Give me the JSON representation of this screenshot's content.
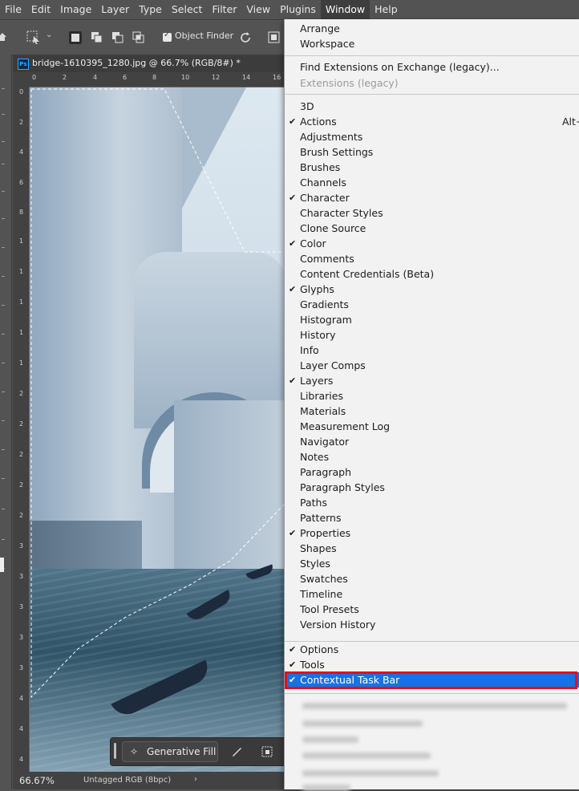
{
  "menubar": {
    "items": [
      "File",
      "Edit",
      "Image",
      "Layer",
      "Type",
      "Select",
      "Filter",
      "View",
      "Plugins",
      "Window",
      "Help"
    ],
    "active": "Window"
  },
  "options_bar": {
    "object_finder_label": "Object Finder"
  },
  "document": {
    "tab_title": "bridge-1610395_1280.jpg @ 66.7% (RGB/8#) *",
    "ps_badge": "Ps",
    "ruler_top": [
      "0",
      "2",
      "4",
      "6",
      "8",
      "10",
      "12",
      "14",
      "16"
    ],
    "ruler_left": [
      "0",
      "2",
      "4",
      "6",
      "8",
      "1",
      "1",
      "1",
      "1",
      "1",
      "2",
      "2",
      "2",
      "2",
      "2",
      "3",
      "3",
      "3",
      "3",
      "3",
      "4",
      "4",
      "4"
    ]
  },
  "context_bar": {
    "generative_fill_label": "Generative Fill"
  },
  "status_bar": {
    "zoom": "66.67%",
    "doc_info": "Untagged RGB (8bpc)",
    "arrow": "›"
  },
  "window_menu": {
    "group1": [
      {
        "label": "Arrange"
      },
      {
        "label": "Workspace"
      }
    ],
    "group2": [
      {
        "label": "Find Extensions on Exchange (legacy)..."
      },
      {
        "label": "Extensions (legacy)",
        "disabled": true
      }
    ],
    "group3": [
      {
        "label": "3D",
        "checked": false
      },
      {
        "label": "Actions",
        "checked": true,
        "shortcut": "Alt+"
      },
      {
        "label": "Adjustments",
        "checked": false
      },
      {
        "label": "Brush Settings",
        "checked": false
      },
      {
        "label": "Brushes",
        "checked": false
      },
      {
        "label": "Channels",
        "checked": false
      },
      {
        "label": "Character",
        "checked": true
      },
      {
        "label": "Character Styles",
        "checked": false
      },
      {
        "label": "Clone Source",
        "checked": false
      },
      {
        "label": "Color",
        "checked": true
      },
      {
        "label": "Comments",
        "checked": false
      },
      {
        "label": "Content Credentials (Beta)",
        "checked": false
      },
      {
        "label": "Glyphs",
        "checked": true
      },
      {
        "label": "Gradients",
        "checked": false
      },
      {
        "label": "Histogram",
        "checked": false
      },
      {
        "label": "History",
        "checked": false
      },
      {
        "label": "Info",
        "checked": false
      },
      {
        "label": "Layer Comps",
        "checked": false
      },
      {
        "label": "Layers",
        "checked": true
      },
      {
        "label": "Libraries",
        "checked": false
      },
      {
        "label": "Materials",
        "checked": false
      },
      {
        "label": "Measurement Log",
        "checked": false
      },
      {
        "label": "Navigator",
        "checked": false
      },
      {
        "label": "Notes",
        "checked": false
      },
      {
        "label": "Paragraph",
        "checked": false
      },
      {
        "label": "Paragraph Styles",
        "checked": false
      },
      {
        "label": "Paths",
        "checked": false
      },
      {
        "label": "Patterns",
        "checked": false
      },
      {
        "label": "Properties",
        "checked": true
      },
      {
        "label": "Shapes",
        "checked": false
      },
      {
        "label": "Styles",
        "checked": false
      },
      {
        "label": "Swatches",
        "checked": false
      },
      {
        "label": "Timeline",
        "checked": false
      },
      {
        "label": "Tool Presets",
        "checked": false
      },
      {
        "label": "Version History",
        "checked": false
      }
    ],
    "group4": [
      {
        "label": "Options",
        "checked": true
      },
      {
        "label": "Tools",
        "checked": true
      },
      {
        "label": "Contextual Task Bar",
        "checked": true,
        "highlighted": true
      }
    ],
    "check_glyph": "✔",
    "highlight_color": "#1473e6",
    "annotation_color": "#e0101d"
  }
}
